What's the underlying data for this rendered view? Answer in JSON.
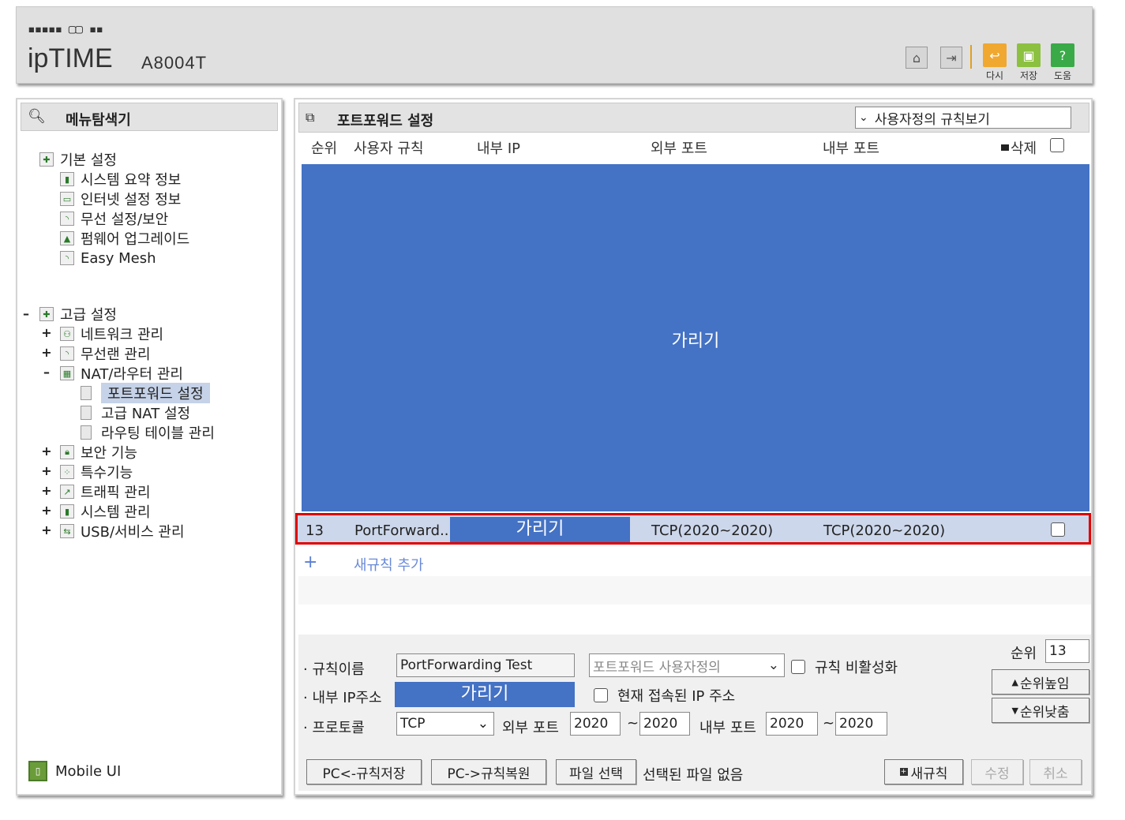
{
  "header": {
    "brand": "ipTIME",
    "model": "A8004T",
    "buttons": [
      {
        "label": "다시",
        "icon": "redo-icon"
      },
      {
        "label": "저장",
        "icon": "save-icon"
      },
      {
        "label": "도움",
        "icon": "help-icon"
      }
    ]
  },
  "sidebar": {
    "title": "메뉴탐색기",
    "basic": {
      "label": "기본 설정",
      "items": [
        "시스템 요약 정보",
        "인터넷 설정 정보",
        "무선 설정/보안",
        "펌웨어 업그레이드",
        "Easy Mesh"
      ]
    },
    "advanced": {
      "label": "고급 설정",
      "items": [
        {
          "toggle": "+",
          "label": "네트워크 관리"
        },
        {
          "toggle": "+",
          "label": "무선랜 관리"
        },
        {
          "toggle": "-",
          "label": "NAT/라우터 관리"
        }
      ],
      "nat_children": [
        "포트포워드 설정",
        "고급 NAT 설정",
        "라우팅 테이블 관리"
      ],
      "more": [
        {
          "toggle": "+",
          "label": "보안 기능"
        },
        {
          "toggle": "+",
          "label": "특수기능"
        },
        {
          "toggle": "+",
          "label": "트래픽 관리"
        },
        {
          "toggle": "+",
          "label": "시스템 관리"
        },
        {
          "toggle": "+",
          "label": "USB/서비스 관리"
        }
      ]
    },
    "mobile_ui": "Mobile UI"
  },
  "main": {
    "title": "포트포워드 설정",
    "view_select": "사용자정의 규칙보기",
    "columns": {
      "order": "순위",
      "rule": "사용자 규칙",
      "internal_ip": "내부 IP",
      "external_port": "외부 포트",
      "internal_port": "내부 포트",
      "delete": "삭제"
    },
    "mask_label": "가리기",
    "row": {
      "order": "13",
      "rule": "PortForward...",
      "ip_mask": "가리기",
      "external_port": "TCP(2020~2020)",
      "internal_port": "TCP(2020~2020)"
    },
    "add_rule": "새규칙 추가"
  },
  "form": {
    "rule_name_label": "규칙이름",
    "rule_name_value": "PortForwarding Test",
    "preset_select": "포트포워드 사용자정의",
    "disable_rule_label": "규칙 비활성화",
    "internal_ip_label": "내부 IP주소",
    "internal_ip_mask": "가리기",
    "current_ip_label": "현재 접속된 IP 주소",
    "protocol_label": "프로토콜",
    "protocol_value": "TCP",
    "external_port_label": "외부 포트",
    "external_port_from": "2020",
    "external_port_to": "2020",
    "internal_port_label": "내부 포트",
    "internal_port_from": "2020",
    "internal_port_to": "2020",
    "tilde": "~",
    "order_label": "순위",
    "order_value": "13",
    "raise_button": "순위높임",
    "lower_button": "순위낮춤",
    "save_to_pc": "PC<-규칙저장",
    "restore_from_pc": "PC->규칙복원",
    "file_select": "파일 선택",
    "no_file": "선택된 파일 없음",
    "new_rule": "새규칙",
    "modify": "수정",
    "cancel": "취소"
  }
}
